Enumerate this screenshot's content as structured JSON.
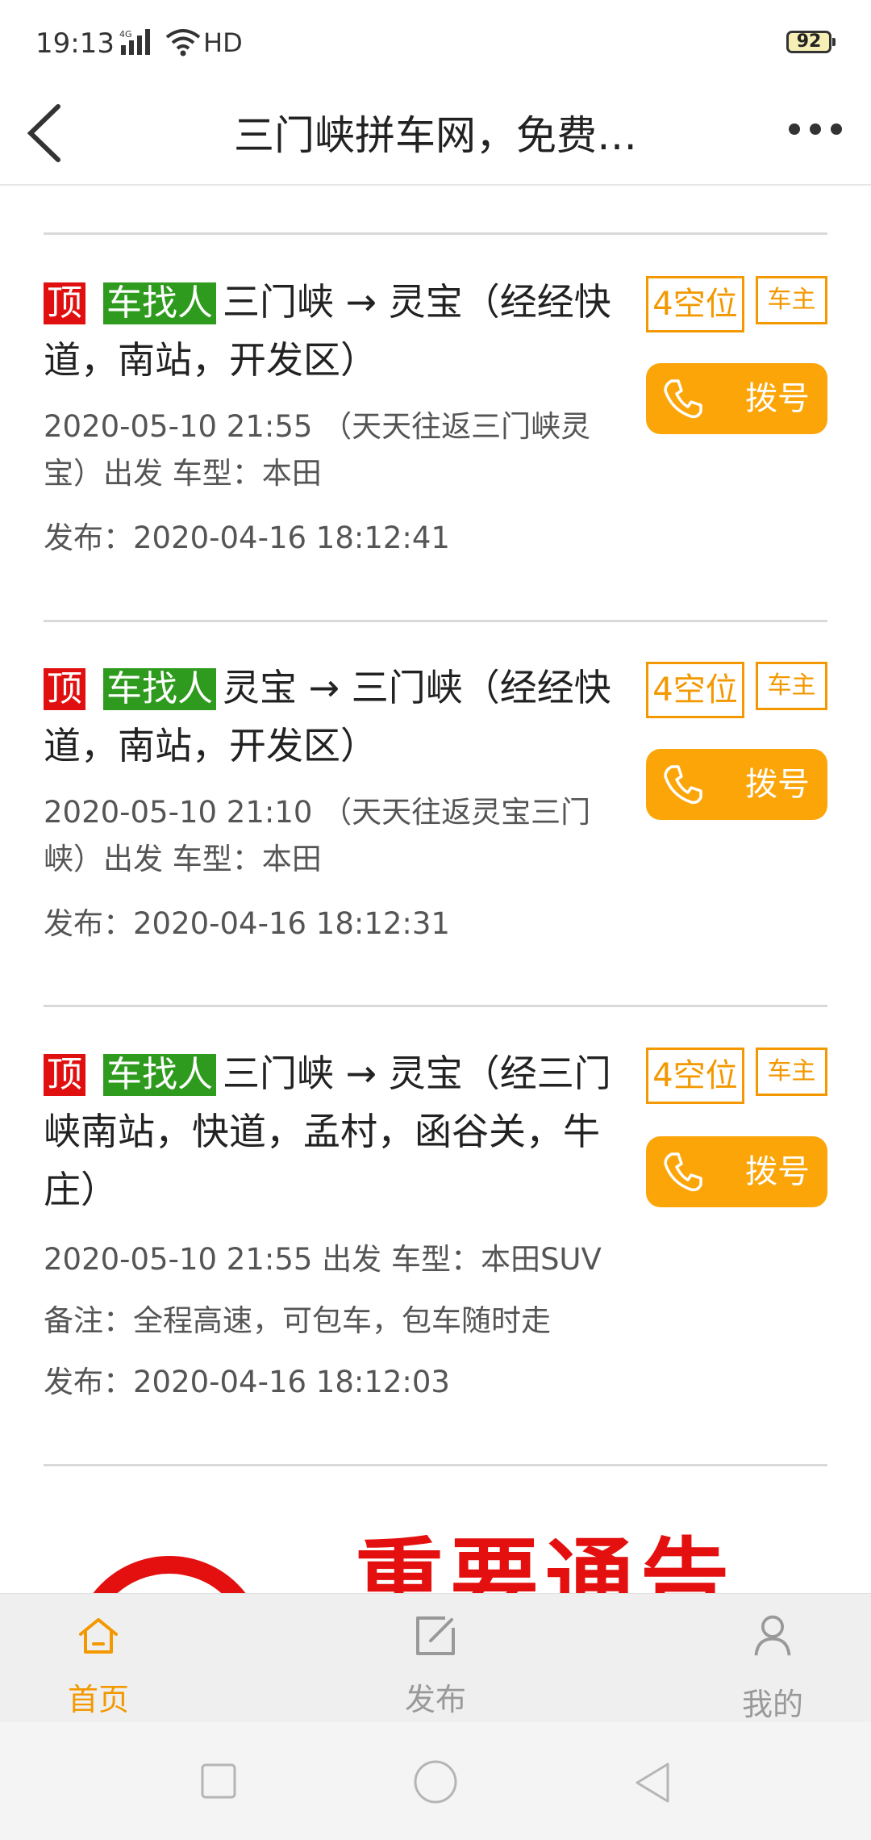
{
  "status_bar": {
    "time": "19:13",
    "network": "4G",
    "hd": "HD",
    "battery": "92"
  },
  "header": {
    "title": "三门峡拼车网，免费…"
  },
  "listings": [
    {
      "tag_top": "顶",
      "tag_type": "车找人",
      "route": "三门峡 → 灵宝（经经快道，南站，开发区）",
      "detail": "2020-05-10 21:55 （天天往返三门峡灵宝）出发 车型：本田",
      "note": "",
      "published": "发布：2020-04-16 18:12:41",
      "seats": "4空位",
      "role": "车主",
      "dial_label": "拨号"
    },
    {
      "tag_top": "顶",
      "tag_type": "车找人",
      "route": "灵宝 → 三门峡（经经快道，南站，开发区）",
      "detail": "2020-05-10 21:10 （天天往返灵宝三门峡）出发 车型：本田",
      "note": "",
      "published": "发布：2020-04-16 18:12:31",
      "seats": "4空位",
      "role": "车主",
      "dial_label": "拨号"
    },
    {
      "tag_top": "顶",
      "tag_type": "车找人",
      "route": "三门峡 → 灵宝（经三门峡南站，快道，孟村，函谷关，牛庄）",
      "detail": "2020-05-10 21:55 出发 车型：本田SUV",
      "note": "备注：全程高速，可包车，包车随时走",
      "published": "发布：2020-04-16 18:12:03",
      "seats": "4空位",
      "role": "车主",
      "dial_label": "拨号"
    }
  ],
  "banner": {
    "text": "重要通告"
  },
  "bottom_nav": [
    {
      "label": "首页",
      "icon": "home-icon",
      "active": true
    },
    {
      "label": "发布",
      "icon": "edit-icon",
      "active": false
    },
    {
      "label": "我的",
      "icon": "user-icon",
      "active": false
    }
  ],
  "colors": {
    "accent": "#fca508",
    "active_nav": "#f39800",
    "tag_red": "#e01010",
    "tag_green": "#2f9b1e"
  }
}
